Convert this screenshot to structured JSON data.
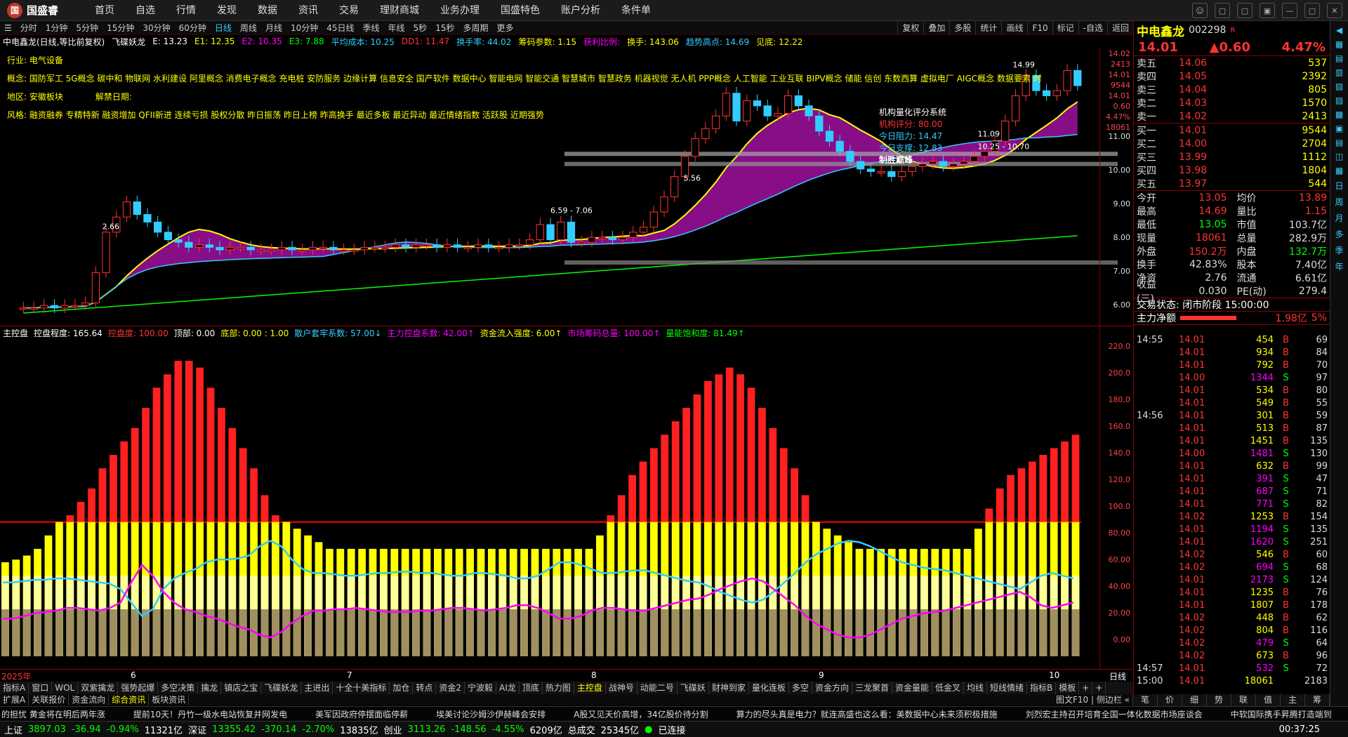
{
  "app": {
    "logo_text": "国盛睿",
    "menu": [
      "首页",
      "自选",
      "行情",
      "发现",
      "数据",
      "资讯",
      "交易",
      "理财商城",
      "业务办理",
      "国盛特色",
      "账户分析",
      "条件单"
    ],
    "win_buttons": [
      "☺",
      "▢",
      "▢",
      "▣",
      "—",
      "▢",
      "✕"
    ]
  },
  "periods": {
    "items": [
      "分时",
      "1分钟",
      "5分钟",
      "15分钟",
      "30分钟",
      "60分钟",
      "日线",
      "周线",
      "月线",
      "10分钟",
      "45日线",
      "季线",
      "年线",
      "5秒",
      "15秒",
      "多周期",
      "更多"
    ],
    "active": "日线"
  },
  "tools": [
    "复权",
    "叠加",
    "多股",
    "统计",
    "画线",
    "F10",
    "标记",
    "-自选",
    "返回"
  ],
  "info": {
    "stock": "中电鑫龙(日线,等比前复权)",
    "formula": "飞碟妖龙",
    "e1": "E: 13.23",
    "e2": "E1: 12.35",
    "e3": "E2: 10.35",
    "e4": "E3: 7.88",
    "avg": "平均成本: 10.25",
    "dd": "DD1: 11.47",
    "turnover": "换手率: 44.02",
    "chip": "筹码参数: 1.15",
    "profit": "获利比例:",
    "hs": "换手: 143.06",
    "trend": "趋势高点: 14.69",
    "top": "见底: 12.22"
  },
  "labels": {
    "industry": "行业: 电气设备",
    "concept": "概念: 国防军工 5G概念 碳中和 物联网 水利建设 阿里概念 消费电子概念 充电桩 安防服务 边缘计算 信息安全 国产软件 数据中心 智能电网 智能交通 智慧城市 智慧政务 机器视觉 无人机 PPP概念 人工智能 工业互联 BIPV概念 储能 信创 东数西算 虚拟电厂 AIGC概念 数据要素 时",
    "region": "地区: 安徽板块",
    "unlock": "解禁日期:",
    "style": "风格: 融资融券 专精特新 融资增加 QFII新进 连续亏损 股权分散 昨日振荡 昨日上榜 昨高换手 最近多板 最近异动 最近情绪指数 活跃股 近期强势"
  },
  "quant": {
    "title": "机构量化评分系统",
    "score": "机构评分: 80.00",
    "resist": "今日阻力: 14.47",
    "support": "今日支撑: 12.83",
    "brand": "制胜巅峰"
  },
  "y1": [
    "14.02",
    "2413",
    "14.01",
    "9544",
    "14.01",
    "0.60",
    "4.47%",
    "18061",
    "11.00",
    "10.00",
    "9.00",
    "8.00",
    "7.00",
    "6.00"
  ],
  "y1_labels_on_chart": [
    "14.99",
    "11.09",
    "10.25 - 10.70",
    "6.59 - 7.06",
    "5.56",
    "2.66"
  ],
  "candles": [
    5.2,
    5.2,
    5.3,
    5.2,
    5.3,
    5.3,
    5.4,
    6.6,
    8.2,
    8.8,
    9.4,
    8.9,
    8.6,
    8.2,
    7.9,
    7.8,
    7.6,
    7.7,
    7.6,
    7.5,
    7.6,
    7.6,
    7.5,
    7.5,
    7.5,
    7.6,
    7.5,
    7.5,
    7.6,
    7.6,
    7.5,
    7.5,
    7.5,
    7.6,
    7.6,
    7.6,
    7.7,
    7.6,
    7.7,
    7.7,
    7.6,
    7.7,
    7.6,
    7.6,
    7.7,
    7.6,
    7.6,
    7.7,
    7.7,
    7.9,
    8.5,
    7.9,
    8.6,
    7.8,
    7.8,
    8.0,
    8.0,
    7.9,
    8.0,
    8.2,
    8.4,
    9.0,
    9.6,
    10.4,
    11.2,
    11.9,
    12.3,
    12.8,
    13.7,
    12.6,
    13.4,
    13.2,
    12.8,
    12.9,
    13.6,
    13.2,
    12.8,
    12.2,
    11.8,
    11.4,
    11.0,
    10.7,
    10.6,
    10.6,
    10.4,
    10.6,
    10.8,
    10.9,
    11.0,
    10.8,
    10.9,
    11.0,
    11.2,
    11.4,
    11.8,
    12.6,
    13.6,
    14.4,
    13.8,
    13.6,
    13.8,
    14.6,
    14.0
  ],
  "ind": {
    "title": "主控盘",
    "ctrl": "控盘程度: 165.64",
    "ctrl2": "控盘度: 100.00",
    "top": "顶部: 0.00",
    "bottom": "底部: 0.00 : 1.00",
    "retail": "散户套牢系数: 57.00↓",
    "main": "主力控盘系数: 42.00↑",
    "flow": "资金流入强度: 6.00↑",
    "chip": "市场筹码总量: 100.00↑",
    "energy": "量能饱和度: 81.49↑"
  },
  "y2": [
    "220.0",
    "200.0",
    "180.0",
    "160.0",
    "140.0",
    "120.0",
    "100.0",
    "80.00",
    "60.00",
    "40.00",
    "20.00",
    "0.00"
  ],
  "bars": [
    70,
    72,
    75,
    80,
    90,
    100,
    105,
    115,
    125,
    140,
    150,
    160,
    170,
    185,
    200,
    210,
    220,
    220,
    215,
    200,
    185,
    170,
    155,
    140,
    120,
    105,
    100,
    95,
    90,
    85,
    80,
    80,
    80,
    80,
    80,
    80,
    80,
    80,
    80,
    80,
    80,
    80,
    80,
    80,
    80,
    80,
    80,
    80,
    80,
    80,
    80,
    80,
    80,
    80,
    80,
    90,
    105,
    120,
    135,
    145,
    155,
    165,
    175,
    185,
    195,
    205,
    210,
    215,
    210,
    200,
    185,
    170,
    155,
    140,
    120,
    100,
    95,
    90,
    85,
    80,
    80,
    80,
    80,
    80,
    80,
    80,
    80,
    80,
    80,
    80,
    95,
    110,
    125,
    135,
    140,
    145,
    150,
    155,
    160,
    165
  ],
  "cyan_line": [
    55,
    55,
    56,
    57,
    57,
    58,
    58,
    57,
    56,
    55,
    54,
    50,
    40,
    30,
    35,
    50,
    58,
    62,
    65,
    70,
    72,
    72,
    73,
    75,
    82,
    86,
    82,
    72,
    65,
    62,
    62,
    61,
    60,
    60,
    61,
    62,
    62,
    63,
    63,
    62,
    62,
    61,
    60,
    60,
    62,
    62,
    61,
    60,
    58,
    58,
    60,
    65,
    70,
    70,
    68,
    65,
    62,
    62,
    63,
    64,
    64,
    62,
    60,
    58,
    56,
    55,
    52,
    48,
    45,
    42,
    40,
    42,
    48,
    55,
    62,
    70,
    76,
    80,
    84,
    86,
    85,
    82,
    78,
    74,
    70,
    68,
    66,
    65,
    64,
    62,
    60,
    58,
    56,
    54,
    52,
    50,
    55,
    60,
    62,
    60,
    58
  ],
  "magenta_line": [
    28,
    28,
    30,
    32,
    33,
    34,
    36,
    36,
    35,
    34,
    36,
    40,
    55,
    68,
    60,
    48,
    40,
    35,
    33,
    30,
    28,
    25,
    22,
    20,
    16,
    14,
    18,
    25,
    30,
    34,
    34,
    35,
    35,
    36,
    35,
    34,
    33,
    33,
    33,
    34,
    34,
    35,
    36,
    36,
    35,
    34,
    35,
    36,
    38,
    38,
    36,
    32,
    28,
    28,
    30,
    34,
    36,
    36,
    35,
    34,
    34,
    36,
    38,
    40,
    42,
    43,
    46,
    50,
    53,
    56,
    58,
    56,
    50,
    44,
    38,
    30,
    24,
    20,
    16,
    14,
    14,
    16,
    20,
    24,
    28,
    30,
    32,
    33,
    34,
    36,
    38,
    40,
    42,
    44,
    46,
    48,
    44,
    38,
    36,
    38,
    40
  ],
  "xaxis": {
    "labels": [
      "2025年",
      "6",
      "7",
      "8",
      "9",
      "10"
    ],
    "right": "日线"
  },
  "tabs": [
    "指标A",
    "窗口",
    "WOL",
    "双紫擒龙",
    "强势起爆",
    "多空决策",
    "擒龙",
    "镇店之宝",
    "飞碟妖龙",
    "主进出",
    "十全十美指标",
    "加仓",
    "转点",
    "资金2",
    "宁波毅",
    "AI龙",
    "顶底",
    "热力图",
    "主控盘",
    "战神号",
    "动能二号",
    "飞碟妖",
    "财神到家",
    "量化连板",
    "多空",
    "资金方向",
    "三龙聚首",
    "资金量能",
    "低金叉",
    "均线",
    "短线情绪",
    "指标B",
    "模板",
    "+",
    "+"
  ],
  "tabs_active": "主控盘",
  "tabs2": [
    "扩展A",
    "关联报价",
    "资金流向",
    "综合资讯",
    "板块资讯"
  ],
  "tabs2_active": "综合资讯",
  "tabs2_right": "图文F10 | 侧边栏 «",
  "ticker": [
    "的担忧 黄金将在明后两年涨",
    "提前10天！丹竹一级水电站恢复并网发电",
    "美军因政府停摆面临停薪",
    "埃美讨论沙姆沙伊赫峰会安排",
    "A股又见天价高增，34亿股价待分割",
    "算力的尽头真是电力？就连高盛也这么看：美数据中心未来须积极措施",
    "刘烈宏主持召开培育全国一体化数据市场座谈会",
    "中软国际携手昇腾打造端到"
  ],
  "status": {
    "sh": "上证",
    "sh_val": "3897.03",
    "sh_chg": "-36.94",
    "sh_pct": "-0.94%",
    "sh_amt": "11321亿",
    "sz": "深证",
    "sz_val": "13355.42",
    "sz_chg": "-370.14",
    "sz_pct": "-2.70%",
    "sz_amt": "13835亿",
    "cy": "创业",
    "cy_val": "3113.26",
    "cy_chg": "-148.56",
    "cy_pct": "-4.55%",
    "cy_amt": "6209亿",
    "total": "总成交",
    "total_val": "25345亿",
    "conn": "已连接",
    "time": "00:37:25"
  },
  "quote": {
    "name": "中电鑫龙",
    "code": "002298",
    "flag": "R",
    "price": "14.01",
    "chg": "▲0.60",
    "pct": "4.47%",
    "asks": [
      [
        "卖五",
        "14.06",
        "537"
      ],
      [
        "卖四",
        "14.05",
        "2392"
      ],
      [
        "卖三",
        "14.04",
        "805"
      ],
      [
        "卖二",
        "14.03",
        "1570"
      ],
      [
        "卖一",
        "14.02",
        "2413"
      ]
    ],
    "bids": [
      [
        "买一",
        "14.01",
        "9544"
      ],
      [
        "买二",
        "14.00",
        "2704"
      ],
      [
        "买三",
        "13.99",
        "1112"
      ],
      [
        "买四",
        "13.98",
        "1804"
      ],
      [
        "买五",
        "13.97",
        "544"
      ]
    ],
    "stats": [
      [
        "今开",
        "13.05",
        "均价",
        "13.89"
      ],
      [
        "最高",
        "14.69",
        "量比",
        "1.15"
      ],
      [
        "最低",
        "13.05",
        "市值",
        "103.7亿"
      ],
      [
        "现量",
        "18061",
        "总量",
        "282.9万"
      ],
      [
        "外盘",
        "150.2万",
        "内盘",
        "132.7万"
      ],
      [
        "换手",
        "42.83%",
        "股本",
        "7.40亿"
      ],
      [
        "净资",
        "2.76",
        "流通",
        "6.61亿"
      ],
      [
        "收益(三)",
        "0.030",
        "PE(动)",
        "279.4"
      ]
    ],
    "state": "交易状态: 闭市阶段 15:00:00",
    "netflow_label": "主力净额",
    "netflow_val": "1.98亿",
    "netflow_pct": "5%"
  },
  "trades": [
    [
      "14:55",
      "14.01",
      "454",
      "B",
      "69"
    ],
    [
      "",
      "14.01",
      "934",
      "B",
      "84"
    ],
    [
      "",
      "14.01",
      "792",
      "B",
      "70"
    ],
    [
      "",
      "14.00",
      "1344",
      "S",
      "97"
    ],
    [
      "",
      "14.01",
      "534",
      "B",
      "80"
    ],
    [
      "",
      "14.01",
      "549",
      "B",
      "55"
    ],
    [
      "14:56",
      "14.01",
      "301",
      "B",
      "59"
    ],
    [
      "",
      "14.01",
      "513",
      "B",
      "87"
    ],
    [
      "",
      "14.01",
      "1451",
      "B",
      "135"
    ],
    [
      "",
      "14.00",
      "1481",
      "S",
      "130"
    ],
    [
      "",
      "14.01",
      "632",
      "B",
      "99"
    ],
    [
      "",
      "14.01",
      "391",
      "S",
      "47"
    ],
    [
      "",
      "14.01",
      "687",
      "S",
      "71"
    ],
    [
      "",
      "14.01",
      "771",
      "S",
      "82"
    ],
    [
      "",
      "14.02",
      "1253",
      "B",
      "154"
    ],
    [
      "",
      "14.01",
      "1194",
      "S",
      "135"
    ],
    [
      "",
      "14.01",
      "1620",
      "S",
      "251"
    ],
    [
      "",
      "14.02",
      "546",
      "B",
      "60"
    ],
    [
      "",
      "14.02",
      "694",
      "S",
      "68"
    ],
    [
      "",
      "14.01",
      "2173",
      "S",
      "124"
    ],
    [
      "",
      "14.01",
      "1235",
      "B",
      "76"
    ],
    [
      "",
      "14.01",
      "1807",
      "B",
      "178"
    ],
    [
      "",
      "14.02",
      "448",
      "B",
      "62"
    ],
    [
      "",
      "14.02",
      "804",
      "B",
      "116"
    ],
    [
      "",
      "14.02",
      "479",
      "S",
      "64"
    ],
    [
      "",
      "14.02",
      "673",
      "B",
      "96"
    ],
    [
      "14:57",
      "14.01",
      "532",
      "S",
      "72"
    ],
    [
      "15:00",
      "14.01",
      "18061",
      "",
      "2183"
    ]
  ],
  "rtabs": [
    "笔",
    "价",
    "细",
    "势",
    "联",
    "值",
    "主",
    "筹"
  ],
  "sidebar": [
    "◀",
    "▦",
    "▤",
    "▥",
    "▧",
    "▨",
    "▩",
    "▣",
    "▤",
    "◫",
    "▦",
    "日",
    "周",
    "月",
    "多",
    "季",
    "年"
  ],
  "colors": {
    "up": "#ff3333",
    "down": "#00ff00",
    "yellow": "#ffff00",
    "cyan": "#33ccff",
    "magenta": "#ff00ff",
    "accent": "#c0392b"
  }
}
